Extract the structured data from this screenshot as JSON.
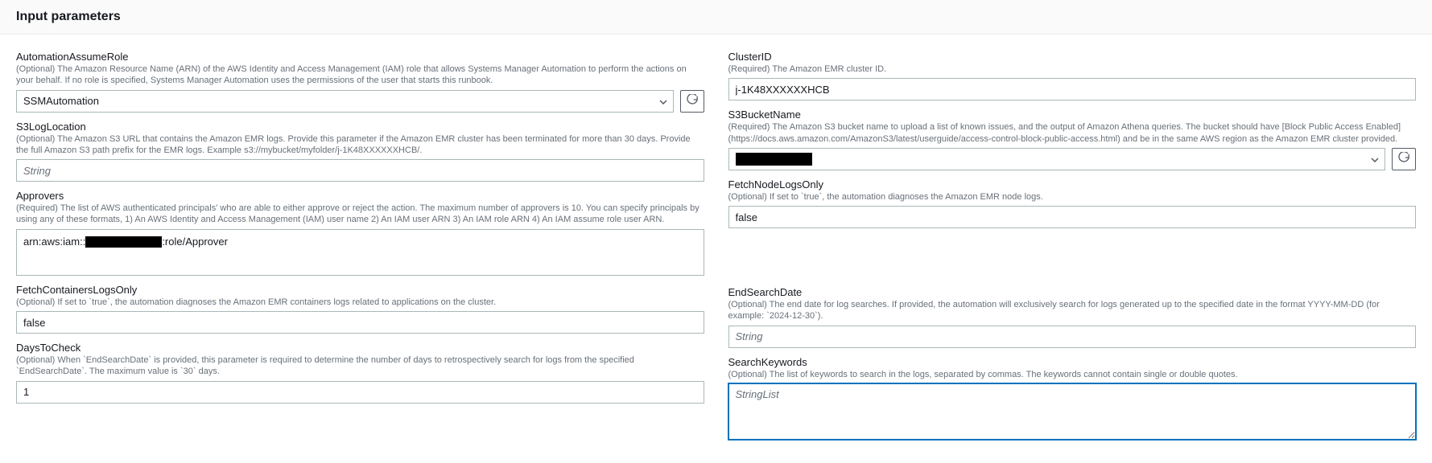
{
  "section_title": "Input parameters",
  "left": {
    "automationAssumeRole": {
      "label": "AutomationAssumeRole",
      "desc": "(Optional) The Amazon Resource Name (ARN) of the AWS Identity and Access Management (IAM) role that allows Systems Manager Automation to perform the actions on your behalf. If no role is specified, Systems Manager Automation uses the permissions of the user that starts this runbook.",
      "value": "SSMAutomation"
    },
    "s3LogLocation": {
      "label": "S3LogLocation",
      "desc": "(Optional) The Amazon S3 URL that contains the Amazon EMR logs. Provide this parameter if the Amazon EMR cluster has been terminated for more than 30 days. Provide the full Amazon S3 path prefix for the EMR logs. Example s3://mybucket/myfolder/j-1K48XXXXXXHCB/.",
      "placeholder": "String",
      "value": ""
    },
    "approvers": {
      "label": "Approvers",
      "desc": "(Required) The list of AWS authenticated principals' who are able to either approve or reject the action. The maximum number of approvers is 10. You can specify principals by using any of these formats, 1) An AWS Identity and Access Management (IAM) user name 2) An IAM user ARN 3) An IAM role ARN 4) An IAM assume role user ARN.",
      "value_prefix": "arn:aws:iam::",
      "value_suffix": ":role/Approver"
    },
    "fetchContainersLogsOnly": {
      "label": "FetchContainersLogsOnly",
      "desc": "(Optional) If set to `true`, the automation diagnoses the Amazon EMR containers logs related to applications on the cluster.",
      "value": "false"
    },
    "daysToCheck": {
      "label": "DaysToCheck",
      "desc": "(Optional) When `EndSearchDate` is provided, this parameter is required to determine the number of days to retrospectively search for logs from the specified `EndSearchDate`. The maximum value is `30` days.",
      "value": "1"
    }
  },
  "right": {
    "clusterID": {
      "label": "ClusterID",
      "desc": "(Required) The Amazon EMR cluster ID.",
      "value": "j-1K48XXXXXXHCB"
    },
    "s3BucketName": {
      "label": "S3BucketName",
      "desc": "(Required) The Amazon S3 bucket name to upload a list of known issues, and the output of Amazon Athena queries. The bucket should have [Block Public Access Enabled](https://docs.aws.amazon.com/AmazonS3/latest/userguide/access-control-block-public-access.html) and be in the same AWS region as the Amazon EMR cluster provided.",
      "value": ""
    },
    "fetchNodeLogsOnly": {
      "label": "FetchNodeLogsOnly",
      "desc": "(Optional) If set to `true`, the automation diagnoses the Amazon EMR node logs.",
      "value": "false"
    },
    "endSearchDate": {
      "label": "EndSearchDate",
      "desc": "(Optional) The end date for log searches. If provided, the automation will exclusively search for logs generated up to the specified date in the format YYYY-MM-DD (for example: `2024-12-30`).",
      "placeholder": "String",
      "value": ""
    },
    "searchKeywords": {
      "label": "SearchKeywords",
      "desc": "(Optional) The list of keywords to search in the logs, separated by commas. The keywords cannot contain single or double quotes.",
      "placeholder": "StringList",
      "value": ""
    }
  }
}
